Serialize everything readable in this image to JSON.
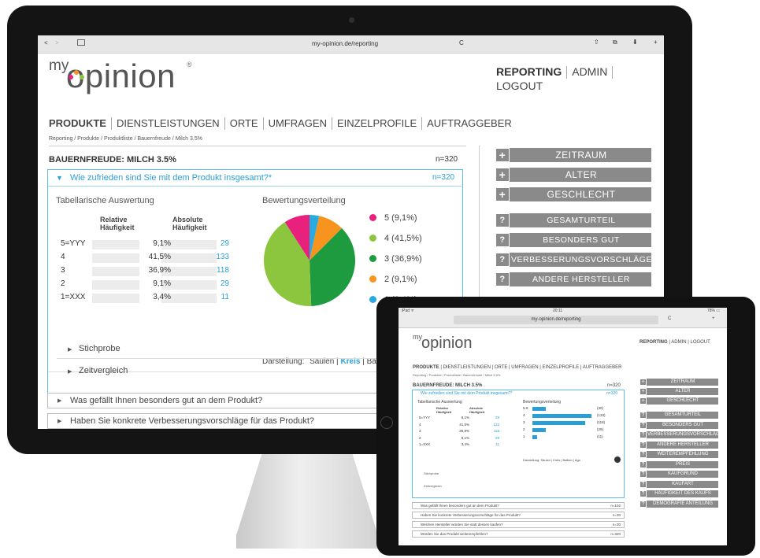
{
  "browser": {
    "url": "my-opinion.de/reporting",
    "back": "<",
    "forward": ">",
    "reload": "C",
    "share": "⇧",
    "tabs": "⧉",
    "download": "⬇",
    "add": "+"
  },
  "logo": {
    "my": "my",
    "opinion": "opinion",
    "reg": "®"
  },
  "topnav": [
    "REPORTING",
    "ADMIN",
    "LOGOUT"
  ],
  "nav": [
    "PRODUKTE",
    "DIENSTLEISTUNGEN",
    "ORTE",
    "UMFRAGEN",
    "EINZELPROFILE",
    "AUFTRAGGEBER"
  ],
  "breadcrumb": "Reporting / Produkte / Produktliste / Bauernfreude / Milch 3.5%",
  "product": {
    "title": "BAUERNFREUDE: MILCH 3.5%",
    "n": "n=320"
  },
  "question": {
    "arrow": "▼",
    "text": "Wie zufrieden sind Sie mit dem Produkt insgesamt?*",
    "n": "n=320"
  },
  "table": {
    "title": "Tabellarische Auswertung",
    "col1": "Relative Häufigkeit",
    "col2": "Absolute Häufigkeit",
    "rows": [
      {
        "label": "5=YYY",
        "rel": "9,1%",
        "abs": "29"
      },
      {
        "label": "4",
        "rel": "41,5%",
        "abs": "133"
      },
      {
        "label": "3",
        "rel": "36,9%",
        "abs": "118"
      },
      {
        "label": "2",
        "rel": "9,1%",
        "abs": "29"
      },
      {
        "label": "1=XXX",
        "rel": "3,4%",
        "abs": "11"
      }
    ]
  },
  "chart_data": {
    "type": "pie",
    "title": "Bewertungsverteilung",
    "slices": [
      {
        "label": "5 (9,1%)",
        "value": 9.1,
        "color": "#e8217c"
      },
      {
        "label": "4 (41,5%)",
        "value": 41.5,
        "color": "#8cc63f"
      },
      {
        "label": "3 (36,9%)",
        "value": 36.9,
        "color": "#1e9b3f"
      },
      {
        "label": "2 (9,1%)",
        "value": 9.1,
        "color": "#f7941d"
      },
      {
        "label": "1 (3,4%)",
        "value": 3.4,
        "color": "#29abe2"
      }
    ]
  },
  "display": {
    "label": "Darstellung:",
    "opt1": "Säulen",
    "opt2": "Kreis",
    "opt3": "Bal"
  },
  "sub": [
    "Stichprobe",
    "Zeitvergleich"
  ],
  "questions": [
    "Was gefällt Ihnen besonders gut an dem Produkt?",
    "Haben Sie konkrete Verbesserungsvorschläge für das Produkt?"
  ],
  "filters": [
    "ZEITRAUM",
    "ALTER",
    "GESCHLECHT"
  ],
  "qfilters": [
    "GESAMTURTEIL",
    "BESONDERS GUT",
    "VERBESSERUNGSVORSCHLÄGE",
    "ANDERE HERSTELLER"
  ],
  "icons": {
    "plus": "+",
    "question": "?",
    "tri": "▶"
  },
  "tablet": {
    "status": {
      "left": "iPad ᯤ",
      "center": "20:11",
      "right": "78% ▭"
    },
    "url": "my-opinion.de/reporting",
    "topnav": [
      "REPORTING",
      "ADMIN",
      "LOGOUT"
    ],
    "nav": [
      "PRODUKTE",
      "DIENSTLEISTUNGEN",
      "ORTE",
      "UMFRAGEN",
      "EINZELPROFILE",
      "AUFTRAGGEBER"
    ],
    "breadcrumb": "Reporting / Produkte / Produktliste / Bauernfreude / Milch 3.5%",
    "product_title": "BAUERNFREUDE: MILCH 3.5%",
    "product_n": "n=320",
    "question": "Wie zufrieden sind Sie mit dem Produkt insgesamt?*",
    "question_n": "n=320",
    "table_title": "Tabellarische Auswertung",
    "chart_title": "Bewertungsverteilung",
    "col1": "Relative Häufigkeit",
    "col2": "Absolute Häufigkeit",
    "rows": [
      {
        "label": "5=YYY",
        "rel": "9,1%",
        "abs": "29"
      },
      {
        "label": "4",
        "rel": "41,5%",
        "abs": "133"
      },
      {
        "label": "3",
        "rel": "36,9%",
        "abs": "118"
      },
      {
        "label": "2",
        "rel": "9,1%",
        "abs": "29"
      },
      {
        "label": "1=XXX",
        "rel": "3,4%",
        "abs": "11"
      }
    ],
    "bars": [
      {
        "label": "5-6",
        "fill": 0.22,
        "value": "(30)"
      },
      {
        "label": "4",
        "fill": 1.0,
        "value": "(133)"
      },
      {
        "label": "3",
        "fill": 0.89,
        "value": "(118)"
      },
      {
        "label": "2",
        "fill": 0.22,
        "value": "(29)"
      },
      {
        "label": "1",
        "fill": 0.08,
        "value": "(11)"
      }
    ],
    "display": "Darstellung: Säulen | Kreis | Balken | Ago",
    "sub": [
      "Stichprobe",
      "Zeitvergleich"
    ],
    "questions": [
      {
        "text": "Was gefällt Ihnen besonders gut an dem Produkt?",
        "n": "n=102"
      },
      {
        "text": "Haben Sie konkrete Verbesserungsvorschläge für das Produkt?",
        "n": "n=30"
      },
      {
        "text": "Welchen Hersteller würden Sie statt dessen kaufen?",
        "n": "n=30"
      },
      {
        "text": "Würden Sie das Produkt weiterempfehlen?",
        "n": "n=320"
      }
    ],
    "filters": [
      "ZEITRAUM",
      "ALTER",
      "GESCHLECHT"
    ],
    "qfilters": [
      "GESAMTURTEIL",
      "BESONDERS GUT",
      "VERBESSERUNGSVORSCHLÄGE",
      "ANDERE HERSTELLER",
      "WEITEREMPFEHLUNG",
      "PREIS",
      "KAUFGRUND",
      "KAUFART",
      "HÄUFIGKEIT DES KAUFS",
      "DEMOGRAFIE ANTEILUNG"
    ]
  }
}
